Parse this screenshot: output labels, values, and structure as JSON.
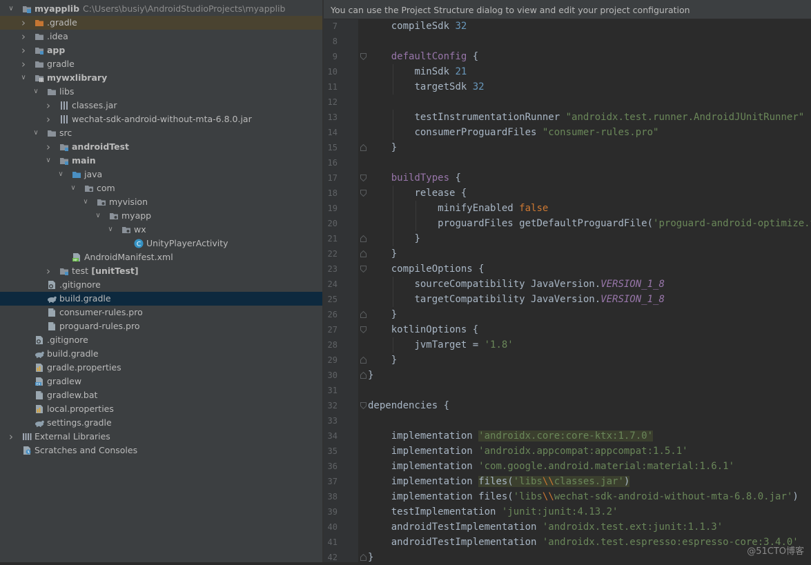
{
  "banner": "You can use the Project Structure dialog to view and edit your project configuration",
  "tree": [
    {
      "depth": 0,
      "arrow": "open",
      "icon": "module",
      "label": "myapplib",
      "bold": true,
      "extra": "C:\\Users\\busiy\\AndroidStudioProjects\\myapplib",
      "state": ""
    },
    {
      "depth": 1,
      "arrow": "closed",
      "icon": "folder-orange",
      "label": ".gradle",
      "bold": false,
      "state": "highlight"
    },
    {
      "depth": 1,
      "arrow": "closed",
      "icon": "folder",
      "label": ".idea",
      "bold": false,
      "state": ""
    },
    {
      "depth": 1,
      "arrow": "closed",
      "icon": "module-folder",
      "label": "app",
      "bold": true,
      "state": ""
    },
    {
      "depth": 1,
      "arrow": "closed",
      "icon": "folder",
      "label": "gradle",
      "bold": false,
      "state": ""
    },
    {
      "depth": 1,
      "arrow": "open",
      "icon": "library-module",
      "label": "mywxlibrary",
      "bold": true,
      "state": ""
    },
    {
      "depth": 2,
      "arrow": "open",
      "icon": "folder",
      "label": "libs",
      "bold": false,
      "state": ""
    },
    {
      "depth": 3,
      "arrow": "closed",
      "icon": "jar",
      "label": "classes.jar",
      "bold": false,
      "state": ""
    },
    {
      "depth": 3,
      "arrow": "closed",
      "icon": "jar",
      "label": "wechat-sdk-android-without-mta-6.8.0.jar",
      "bold": false,
      "state": ""
    },
    {
      "depth": 2,
      "arrow": "open",
      "icon": "folder",
      "label": "src",
      "bold": false,
      "state": ""
    },
    {
      "depth": 3,
      "arrow": "closed",
      "icon": "module-folder",
      "label": "androidTest",
      "bold": true,
      "state": ""
    },
    {
      "depth": 3,
      "arrow": "open",
      "icon": "module-folder",
      "label": "main",
      "bold": true,
      "state": ""
    },
    {
      "depth": 4,
      "arrow": "open",
      "icon": "folder-blue",
      "label": "java",
      "bold": false,
      "state": ""
    },
    {
      "depth": 5,
      "arrow": "open",
      "icon": "package",
      "label": "com",
      "bold": false,
      "state": ""
    },
    {
      "depth": 6,
      "arrow": "open",
      "icon": "package",
      "label": "myvision",
      "bold": false,
      "state": ""
    },
    {
      "depth": 7,
      "arrow": "open",
      "icon": "package",
      "label": "myapp",
      "bold": false,
      "state": ""
    },
    {
      "depth": 8,
      "arrow": "open",
      "icon": "package",
      "label": "wx",
      "bold": false,
      "state": ""
    },
    {
      "depth": 9,
      "arrow": "none",
      "icon": "class",
      "label": "UnityPlayerActivity",
      "bold": false,
      "state": ""
    },
    {
      "depth": 4,
      "arrow": "none",
      "icon": "manifest",
      "label": "AndroidManifest.xml",
      "bold": false,
      "state": ""
    },
    {
      "depth": 3,
      "arrow": "closed",
      "icon": "module-folder",
      "label": "test",
      "bold": false,
      "extra_bold": "[unitTest]",
      "state": ""
    },
    {
      "depth": 2,
      "arrow": "none",
      "icon": "gitignore",
      "label": ".gitignore",
      "bold": false,
      "state": ""
    },
    {
      "depth": 2,
      "arrow": "none",
      "icon": "gradle",
      "label": "build.gradle",
      "bold": false,
      "state": "selected"
    },
    {
      "depth": 2,
      "arrow": "none",
      "icon": "file",
      "label": "consumer-rules.pro",
      "bold": false,
      "state": ""
    },
    {
      "depth": 2,
      "arrow": "none",
      "icon": "file",
      "label": "proguard-rules.pro",
      "bold": false,
      "state": ""
    },
    {
      "depth": 1,
      "arrow": "none",
      "icon": "gitignore",
      "label": ".gitignore",
      "bold": false,
      "state": ""
    },
    {
      "depth": 1,
      "arrow": "none",
      "icon": "gradle",
      "label": "build.gradle",
      "bold": false,
      "state": ""
    },
    {
      "depth": 1,
      "arrow": "none",
      "icon": "properties",
      "label": "gradle.properties",
      "bold": false,
      "state": ""
    },
    {
      "depth": 1,
      "arrow": "none",
      "icon": "script",
      "label": "gradlew",
      "bold": false,
      "state": ""
    },
    {
      "depth": 1,
      "arrow": "none",
      "icon": "file",
      "label": "gradlew.bat",
      "bold": false,
      "state": ""
    },
    {
      "depth": 1,
      "arrow": "none",
      "icon": "properties",
      "label": "local.properties",
      "bold": false,
      "state": ""
    },
    {
      "depth": 1,
      "arrow": "none",
      "icon": "gradle",
      "label": "settings.gradle",
      "bold": false,
      "state": ""
    },
    {
      "depth": 0,
      "arrow": "closed",
      "icon": "libraries",
      "label": "External Libraries",
      "bold": false,
      "state": ""
    },
    {
      "depth": 0,
      "arrow": "none",
      "icon": "scratches",
      "label": "Scratches and Consoles",
      "bold": false,
      "state": ""
    }
  ],
  "code": [
    {
      "n": "7",
      "indent": 1,
      "fold": "",
      "tokens": [
        [
          "compileSdk ",
          ""
        ],
        [
          "32",
          "num"
        ]
      ]
    },
    {
      "n": "8",
      "indent": 0,
      "fold": "",
      "tokens": []
    },
    {
      "n": "9",
      "indent": 1,
      "fold": "open",
      "tokens": [
        [
          "defaultConfig",
          "kw"
        ],
        [
          " {",
          ""
        ]
      ]
    },
    {
      "n": "10",
      "indent": 2,
      "fold": "",
      "tokens": [
        [
          "minSdk ",
          ""
        ],
        [
          "21",
          "num"
        ]
      ]
    },
    {
      "n": "11",
      "indent": 2,
      "fold": "",
      "tokens": [
        [
          "targetSdk ",
          ""
        ],
        [
          "32",
          "num"
        ]
      ]
    },
    {
      "n": "12",
      "indent": 0,
      "fold": "",
      "tokens": []
    },
    {
      "n": "13",
      "indent": 2,
      "fold": "",
      "tokens": [
        [
          "testInstrumentationRunner ",
          ""
        ],
        [
          "\"androidx.test.runner.AndroidJUnitRunner\"",
          "str"
        ]
      ]
    },
    {
      "n": "14",
      "indent": 2,
      "fold": "",
      "tokens": [
        [
          "consumerProguardFiles ",
          ""
        ],
        [
          "\"consumer-rules.pro\"",
          "str"
        ]
      ]
    },
    {
      "n": "15",
      "indent": 1,
      "fold": "close",
      "tokens": [
        [
          "}",
          ""
        ]
      ]
    },
    {
      "n": "16",
      "indent": 0,
      "fold": "",
      "tokens": []
    },
    {
      "n": "17",
      "indent": 1,
      "fold": "open",
      "tokens": [
        [
          "buildTypes",
          "kw"
        ],
        [
          " {",
          ""
        ]
      ]
    },
    {
      "n": "18",
      "indent": 2,
      "fold": "open",
      "tokens": [
        [
          "release {",
          ""
        ]
      ]
    },
    {
      "n": "19",
      "indent": 3,
      "fold": "",
      "tokens": [
        [
          "minifyEnabled ",
          ""
        ],
        [
          "false",
          "orange"
        ]
      ]
    },
    {
      "n": "20",
      "indent": 3,
      "fold": "",
      "tokens": [
        [
          "proguardFiles getDefaultProguardFile(",
          ""
        ],
        [
          "'proguard-android-optimize.txt'",
          "str"
        ],
        [
          "),",
          ""
        ]
      ]
    },
    {
      "n": "21",
      "indent": 2,
      "fold": "close",
      "tokens": [
        [
          "}",
          ""
        ]
      ]
    },
    {
      "n": "22",
      "indent": 1,
      "fold": "close",
      "tokens": [
        [
          "}",
          ""
        ]
      ]
    },
    {
      "n": "23",
      "indent": 1,
      "fold": "open",
      "tokens": [
        [
          "compileOptions {",
          ""
        ]
      ]
    },
    {
      "n": "24",
      "indent": 2,
      "fold": "",
      "tokens": [
        [
          "sourceCompatibility JavaVersion.",
          ""
        ],
        [
          "VERSION_1_8",
          "italic"
        ]
      ]
    },
    {
      "n": "25",
      "indent": 2,
      "fold": "",
      "tokens": [
        [
          "targetCompatibility JavaVersion.",
          ""
        ],
        [
          "VERSION_1_8",
          "italic"
        ]
      ]
    },
    {
      "n": "26",
      "indent": 1,
      "fold": "close",
      "tokens": [
        [
          "}",
          ""
        ]
      ]
    },
    {
      "n": "27",
      "indent": 1,
      "fold": "open",
      "tokens": [
        [
          "kotlinOptions {",
          ""
        ]
      ]
    },
    {
      "n": "28",
      "indent": 2,
      "fold": "",
      "tokens": [
        [
          "jvmTarget = ",
          ""
        ],
        [
          "'1.8'",
          "str"
        ]
      ]
    },
    {
      "n": "29",
      "indent": 1,
      "fold": "close",
      "tokens": [
        [
          "}",
          ""
        ]
      ]
    },
    {
      "n": "30",
      "indent": 0,
      "fold": "close",
      "tokens": [
        [
          "}",
          ""
        ]
      ]
    },
    {
      "n": "31",
      "indent": 0,
      "fold": "",
      "tokens": []
    },
    {
      "n": "32",
      "indent": 0,
      "fold": "open",
      "tokens": [
        [
          "dependencies {",
          ""
        ]
      ]
    },
    {
      "n": "33",
      "indent": 0,
      "fold": "",
      "tokens": []
    },
    {
      "n": "34",
      "indent": 1,
      "fold": "",
      "tokens": [
        [
          "implementation ",
          ""
        ],
        [
          "'androidx.core:core-ktx:1.7.0'",
          "str hlbg"
        ]
      ]
    },
    {
      "n": "35",
      "indent": 1,
      "fold": "",
      "tokens": [
        [
          "implementation ",
          ""
        ],
        [
          "'androidx.appcompat:appcompat:1.5.1'",
          "str"
        ]
      ]
    },
    {
      "n": "36",
      "indent": 1,
      "fold": "",
      "tokens": [
        [
          "implementation ",
          ""
        ],
        [
          "'com.google.android.material:material:1.6.1'",
          "str"
        ]
      ]
    },
    {
      "n": "37",
      "indent": 1,
      "fold": "",
      "tokens": [
        [
          "implementation ",
          ""
        ],
        [
          "files(",
          "hlbg"
        ],
        [
          "'libs",
          "str hlbg"
        ],
        [
          "\\\\",
          "orange hlbg"
        ],
        [
          "classes.jar'",
          "str hlbg"
        ],
        [
          ")",
          "hlbg"
        ]
      ]
    },
    {
      "n": "38",
      "indent": 1,
      "fold": "",
      "tokens": [
        [
          "implementation files(",
          ""
        ],
        [
          "'libs",
          "str"
        ],
        [
          "\\\\",
          "orange"
        ],
        [
          "wechat-sdk-android-without-mta-6.8.0.jar'",
          "str"
        ],
        [
          ")",
          ""
        ]
      ]
    },
    {
      "n": "39",
      "indent": 1,
      "fold": "",
      "tokens": [
        [
          "testImplementation ",
          ""
        ],
        [
          "'junit:junit:4.13.2'",
          "str"
        ]
      ]
    },
    {
      "n": "40",
      "indent": 1,
      "fold": "",
      "tokens": [
        [
          "androidTestImplementation ",
          ""
        ],
        [
          "'androidx.test.ext:junit:1.1.3'",
          "str"
        ]
      ]
    },
    {
      "n": "41",
      "indent": 1,
      "fold": "",
      "tokens": [
        [
          "androidTestImplementation ",
          ""
        ],
        [
          "'androidx.test.espresso:espresso-core:3.4.0'",
          "str"
        ]
      ]
    },
    {
      "n": "42",
      "indent": 0,
      "fold": "close",
      "tokens": [
        [
          "}",
          ""
        ]
      ]
    }
  ],
  "watermark": "@51CTO博客",
  "colors": {
    "tree_bg": "#3c3f41",
    "editor_bg": "#2b2b2b",
    "gutter_bg": "#313335",
    "selection": "#0d293e",
    "keyword": "#9876aa",
    "string": "#6a8759",
    "number": "#6897bb",
    "boolean": "#cc7832"
  }
}
